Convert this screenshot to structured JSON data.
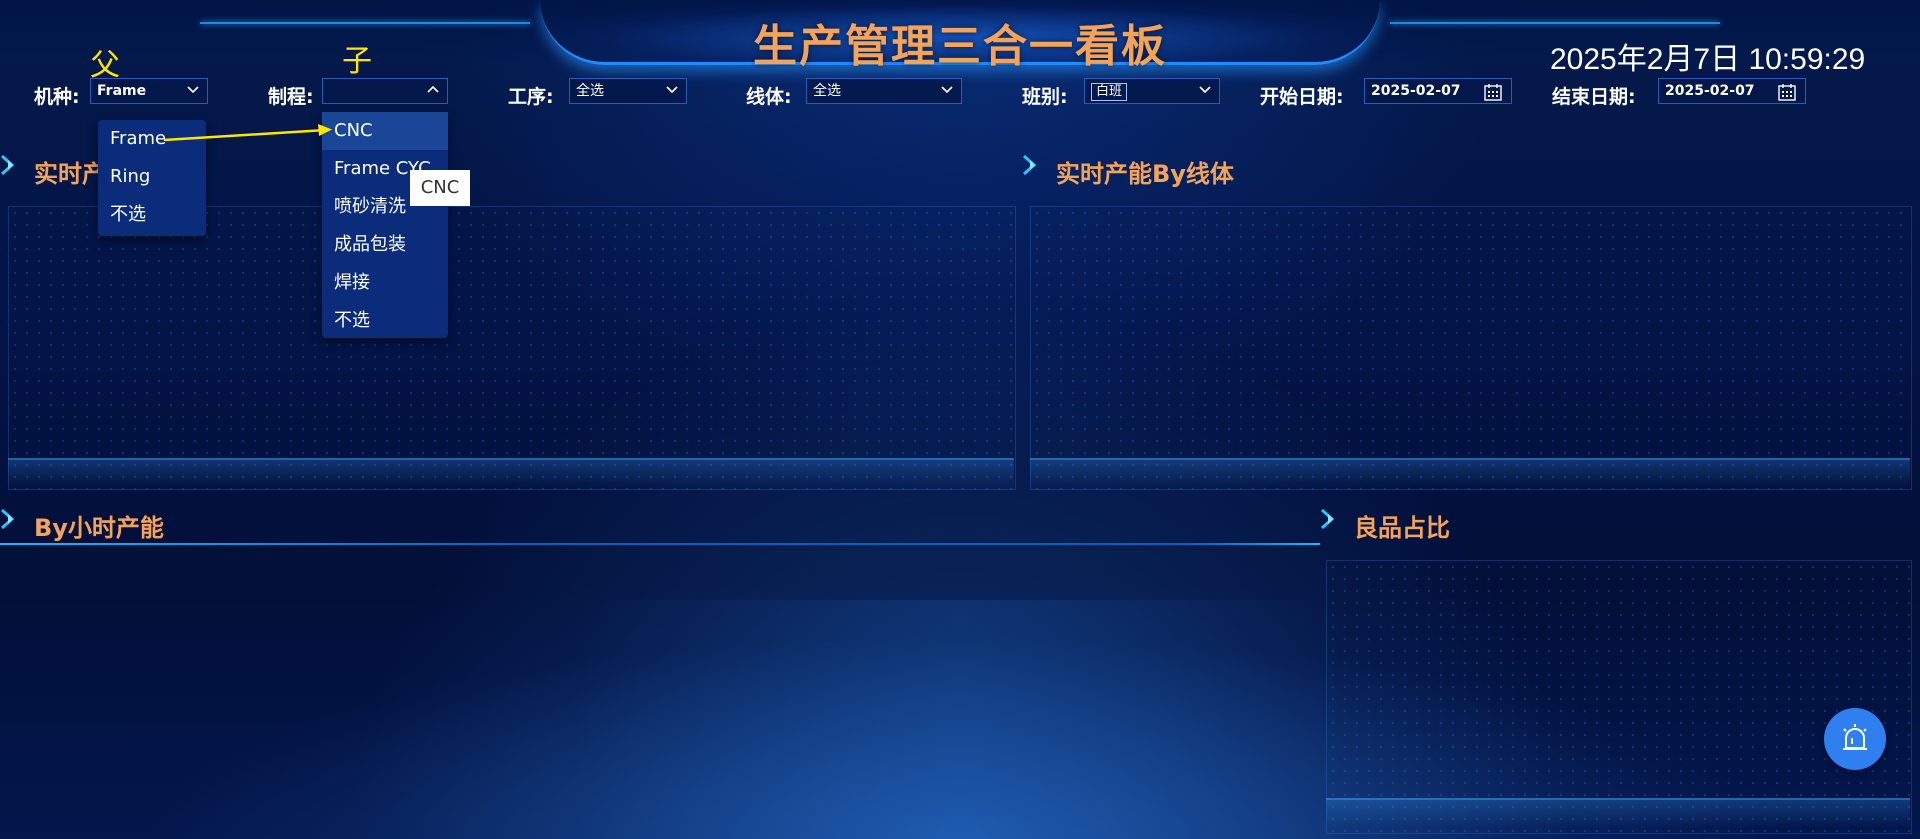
{
  "header": {
    "title": "生产管理三合一看板",
    "datetime": "2025年2月7日 10:59:29"
  },
  "annotations": {
    "parent": "父",
    "child": "子"
  },
  "filters": {
    "machine": {
      "label": "机种:",
      "value": "Frame"
    },
    "process": {
      "label": "制程:",
      "value": ""
    },
    "operation": {
      "label": "工序:",
      "value": "全选"
    },
    "line": {
      "label": "线体:",
      "value": "全选"
    },
    "shift": {
      "label": "班别:",
      "value": "白班"
    },
    "start_date": {
      "label": "开始日期:",
      "value": "2025-02-07"
    },
    "end_date": {
      "label": "结束日期:",
      "value": "2025-02-07"
    }
  },
  "machine_dropdown": {
    "items": [
      "Frame",
      "Ring",
      "不选"
    ]
  },
  "process_dropdown": {
    "items": [
      "CNC",
      "Frame CYC",
      "喷砂清洗",
      "成品包装",
      "焊接",
      "不选"
    ],
    "highlighted": "CNC"
  },
  "tooltip": "CNC",
  "sections": {
    "realtime_left": "实时产",
    "realtime_line": "实时产能By线体",
    "hourly": "By小时产能",
    "yield": "良品占比"
  },
  "icons": {
    "fab": "alarm-bell-icon",
    "section": "chevron-arrow-icon"
  },
  "colors": {
    "title": "#f3a35a",
    "annotation": "#ffe600",
    "accent": "#1e88e5",
    "fab": "#2f7ff0"
  }
}
